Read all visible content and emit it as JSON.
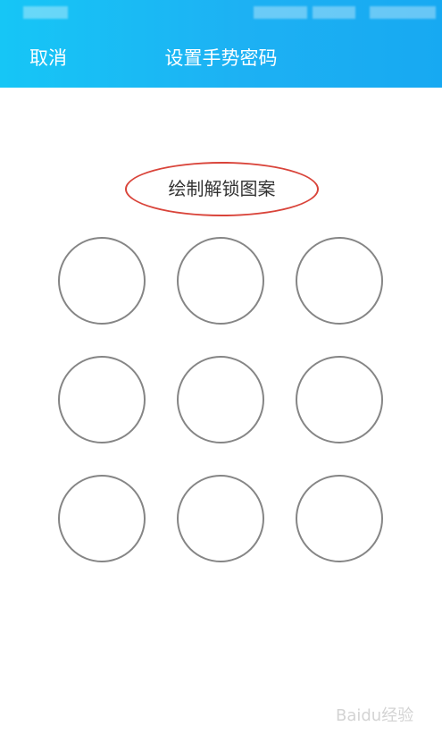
{
  "header": {
    "cancel_label": "取消",
    "title": "设置手势密码",
    "background": "#1db1f3"
  },
  "prompt": {
    "text": "绘制解锁图案",
    "highlight_color": "#d9443a"
  },
  "pattern": {
    "rows": 3,
    "cols": 3,
    "dot_color": "#858585"
  },
  "watermark": {
    "text": "Baidu经验"
  }
}
